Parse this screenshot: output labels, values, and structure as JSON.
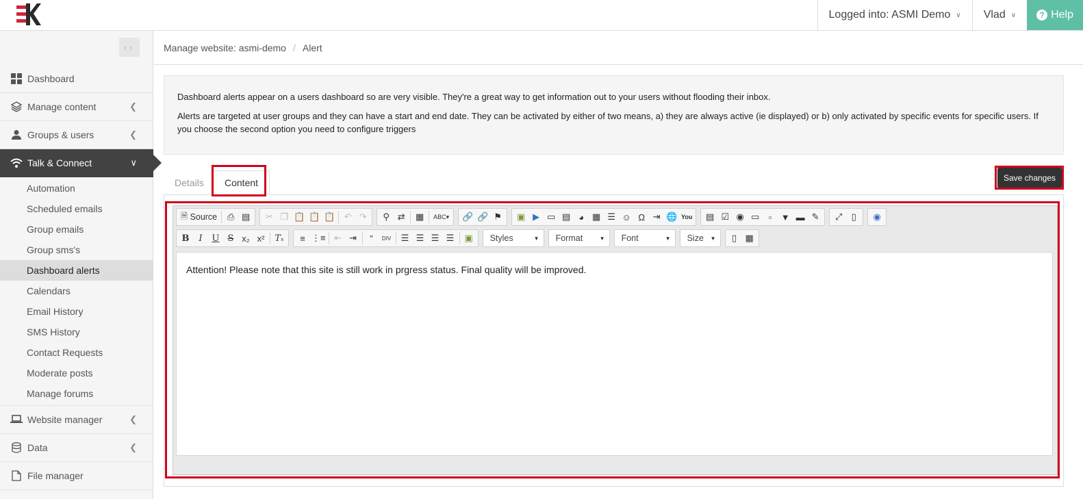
{
  "topbar": {
    "logged_into": "Logged into: ASMI Demo",
    "user": "Vlad",
    "help": "Help"
  },
  "sidebar": {
    "items": [
      {
        "label": "Dashboard",
        "icon": "dashboard-icon"
      },
      {
        "label": "Manage content",
        "icon": "layers-icon"
      },
      {
        "label": "Groups & users",
        "icon": "user-icon"
      },
      {
        "label": "Talk & Connect",
        "icon": "wifi-icon"
      }
    ],
    "talk_connect_sub": [
      "Automation",
      "Scheduled emails",
      "Group emails",
      "Group sms's",
      "Dashboard alerts",
      "Calendars",
      "Email History",
      "SMS History",
      "Contact Requests",
      "Moderate posts",
      "Manage forums"
    ],
    "selected_sub": "Dashboard alerts",
    "items_after": [
      {
        "label": "Website manager",
        "icon": "laptop-icon"
      },
      {
        "label": "Data",
        "icon": "database-icon"
      },
      {
        "label": "File manager",
        "icon": "file-icon"
      }
    ]
  },
  "breadcrumb": {
    "site": "Manage website: asmi-demo",
    "page": "Alert"
  },
  "info": {
    "p1": "Dashboard alerts appear on a users dashboard so are very visible. They're a great way to get information out to your users without flooding their inbox.",
    "p2": "Alerts are targeted at user groups and they can have a start and end date. They can be activated by either of two means, a) they are always active (ie displayed) or b) only activated by specific events for specific users. If you choose the second option you need to configure triggers"
  },
  "tabs": {
    "details": "Details",
    "content": "Content"
  },
  "save_button": "Save changes",
  "editor": {
    "source_label": "Source",
    "combos": {
      "styles": "Styles",
      "format": "Format",
      "font": "Font",
      "size": "Size"
    },
    "content": "Attention! Please note that this site is still work in prgress status. Final quality will be improved."
  },
  "colors": {
    "help_bg": "#5fbfa5",
    "active_nav": "#424242",
    "highlight": "#d0021b"
  }
}
